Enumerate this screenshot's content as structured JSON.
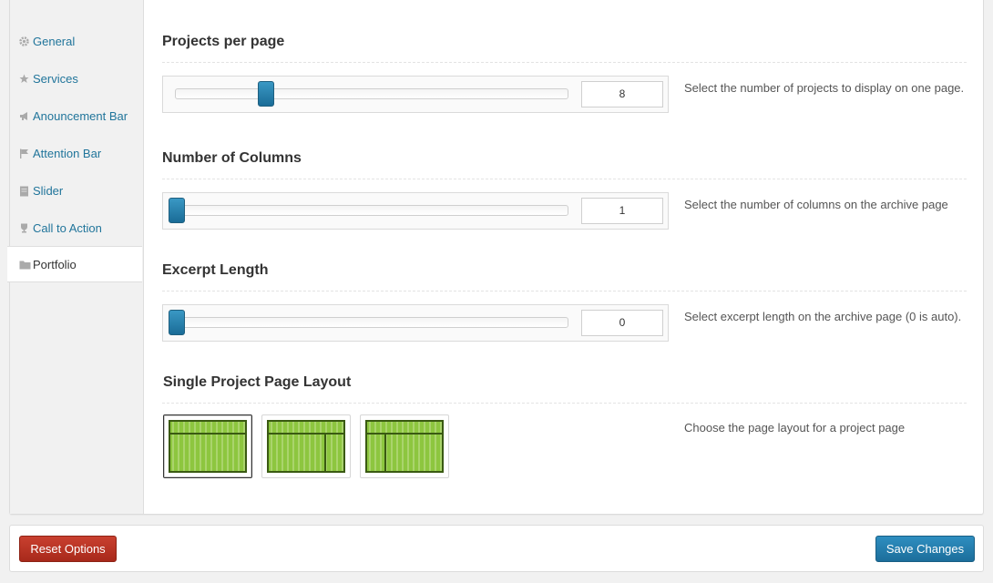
{
  "sidebar": {
    "items": [
      {
        "label": "General",
        "icon": "gear-icon"
      },
      {
        "label": "Services",
        "icon": "star-icon"
      },
      {
        "label": "Anouncement Bar",
        "icon": "megaphone-icon"
      },
      {
        "label": "Attention Bar",
        "icon": "flag-icon"
      },
      {
        "label": "Slider",
        "icon": "document-icon"
      },
      {
        "label": "Call to Action",
        "icon": "trophy-icon"
      },
      {
        "label": "Portfolio",
        "icon": "folder-icon",
        "active": true
      }
    ]
  },
  "sections": {
    "projects_per_page": {
      "title": "Projects per page",
      "value": "8",
      "slider_fraction": 0.23,
      "description": "Select the number of projects to display on one page."
    },
    "number_of_columns": {
      "title": "Number of Columns",
      "value": "1",
      "slider_fraction": 0.0,
      "description": "Select the number of columns on the archive page"
    },
    "excerpt_length": {
      "title": "Excerpt Length",
      "value": "0",
      "slider_fraction": 0.0,
      "description": "Select excerpt length on the archive page (0 is auto)."
    },
    "single_project_layout": {
      "title": "Single Project Page Layout",
      "description": "Choose the page layout for a project page",
      "options": [
        "full-width",
        "right-sidebar",
        "left-sidebar"
      ],
      "selected": "full-width"
    }
  },
  "footer": {
    "reset_label": "Reset Options",
    "save_label": "Save Changes"
  },
  "colors": {
    "accent": "#21759b",
    "slider_thumb": "#2a82b0",
    "layout_green": "#8dc63f",
    "reset_button": "#b8321f",
    "save_button": "#2481b0"
  }
}
